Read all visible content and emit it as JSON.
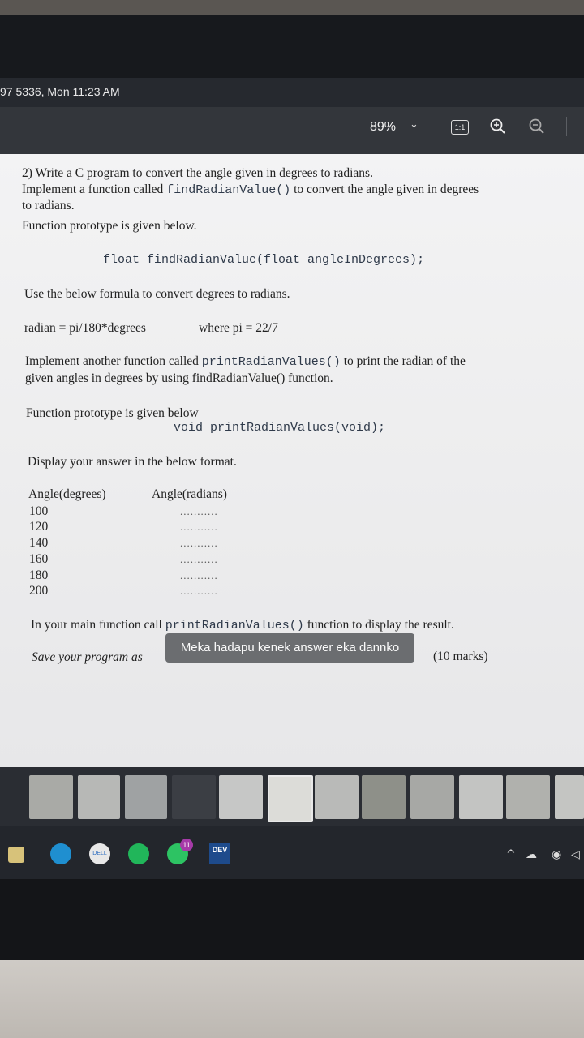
{
  "window": {
    "title": "97 5336, Mon 11:23 AM"
  },
  "toolbar": {
    "zoom": "89%",
    "actual_size_label": "1:1"
  },
  "document": {
    "q_line1": "2)  Write a C program to convert the angle given in degrees to radians.",
    "q_line2_a": "Implement a function called ",
    "q_line2_code": "findRadianValue()",
    "q_line2_b": " to convert the angle given in degrees",
    "q_line3": "to radians.",
    "q_line4": "Function prototype is given below.",
    "prototype1": "float findRadianValue(float angleInDegrees);",
    "formula_intro": "Use the below formula to convert degrees to radians.",
    "formula": "radian = pi/180*degrees",
    "formula_where": "where pi = 22/7",
    "impl2_a": "Implement another function called ",
    "impl2_code": "printRadianValues()",
    "impl2_b": " to print the radian of the",
    "impl2_line2": "given angles in degrees by using findRadianValue() function.",
    "proto2_intro": "Function prototype is given below",
    "prototype2": "void printRadianValues(void);",
    "display_intro": "Display your answer in the below format.",
    "col_degrees": "Angle(degrees)",
    "col_radians": "Angle(radians)",
    "angles": [
      "100",
      "120",
      "140",
      "160",
      "180",
      "200"
    ],
    "placeholder": "...........",
    "main_a": "In your main function call ",
    "main_code": "printRadianValues()",
    "main_b": " function to display the result.",
    "save_text": "Save your program as ",
    "marks": "(10 marks)"
  },
  "toast": {
    "message": "Meka hadapu kenek answer eka dannko"
  },
  "taskbar": {
    "whatsapp_badge": "11",
    "app_label": "DEV"
  }
}
